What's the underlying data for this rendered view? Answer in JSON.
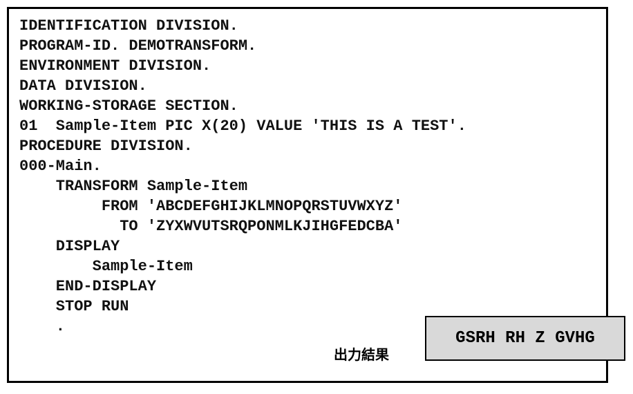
{
  "code": {
    "lines": [
      "IDENTIFICATION DIVISION.",
      "PROGRAM-ID. DEMOTRANSFORM.",
      "ENVIRONMENT DIVISION.",
      "DATA DIVISION.",
      "WORKING-STORAGE SECTION.",
      "01  Sample-Item PIC X(20) VALUE 'THIS IS A TEST'.",
      "PROCEDURE DIVISION.",
      "000-Main.",
      "    TRANSFORM Sample-Item",
      "         FROM 'ABCDEFGHIJKLMNOPQRSTUVWXYZ'",
      "           TO 'ZYXWVUTSRQPONMLKJIHGFEDCBA'",
      "    DISPLAY",
      "        Sample-Item",
      "    END-DISPLAY",
      "    STOP RUN",
      "    ."
    ]
  },
  "output": {
    "label": "出力結果",
    "value": "GSRH RH Z GVHG"
  }
}
